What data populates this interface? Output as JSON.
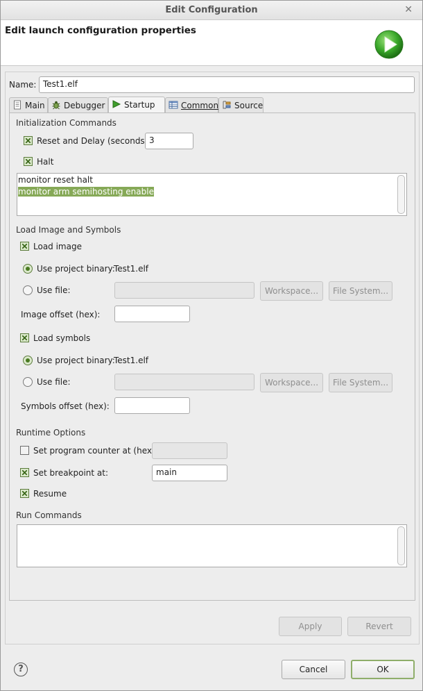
{
  "window": {
    "title": "Edit Configuration",
    "close_glyph": "✕"
  },
  "header": {
    "title": "Edit launch configuration properties",
    "icon": "run-launch-icon",
    "accent_color": "#3aa82a"
  },
  "name_field": {
    "label": "Name:",
    "value": "Test1.elf"
  },
  "tabs": [
    {
      "label": "Main",
      "icon": "document-icon"
    },
    {
      "label": "Debugger",
      "icon": "bug-icon"
    },
    {
      "label": "Startup",
      "icon": "play-icon"
    },
    {
      "label": "Common",
      "icon": "table-icon"
    },
    {
      "label": "Source",
      "icon": "source-lookup-icon"
    }
  ],
  "active_tab": "Startup",
  "init_commands": {
    "heading": "Initialization Commands",
    "reset_and_delay": {
      "label": "Reset and Delay (seconds):",
      "checked": true,
      "value": "3"
    },
    "halt": {
      "label": "Halt",
      "checked": true
    },
    "commands": [
      "monitor reset halt",
      "monitor arm semihosting enable"
    ],
    "selected_line": 1
  },
  "load_image_symbols": {
    "heading": "Load Image and Symbols",
    "load_image": {
      "label": "Load image",
      "checked": true
    },
    "image_use_project_binary": {
      "label": "Use project binary:",
      "value": "Test1.elf",
      "selected": true
    },
    "image_use_file": {
      "label": "Use file:",
      "value": "",
      "selected": false
    },
    "workspace_button": "Workspace...",
    "file_system_button": "File System...",
    "image_offset": {
      "label": "Image offset (hex):",
      "value": ""
    },
    "load_symbols": {
      "label": "Load symbols",
      "checked": true
    },
    "symbols_use_project_binary": {
      "label": "Use project binary:",
      "value": "Test1.elf",
      "selected": true
    },
    "symbols_use_file": {
      "label": "Use file:",
      "value": "",
      "selected": false
    },
    "symbols_offset": {
      "label": "Symbols offset (hex):",
      "value": ""
    }
  },
  "runtime_options": {
    "heading": "Runtime Options",
    "set_pc": {
      "label": "Set program counter at (hex):",
      "checked": false,
      "value": ""
    },
    "set_breakpoint": {
      "label": "Set breakpoint at:",
      "checked": true,
      "value": "main"
    },
    "resume": {
      "label": "Resume",
      "checked": true
    }
  },
  "run_commands": {
    "heading": "Run Commands",
    "commands": []
  },
  "buttons": {
    "apply": "Apply",
    "revert": "Revert",
    "cancel": "Cancel",
    "ok": "OK",
    "help": "?"
  }
}
